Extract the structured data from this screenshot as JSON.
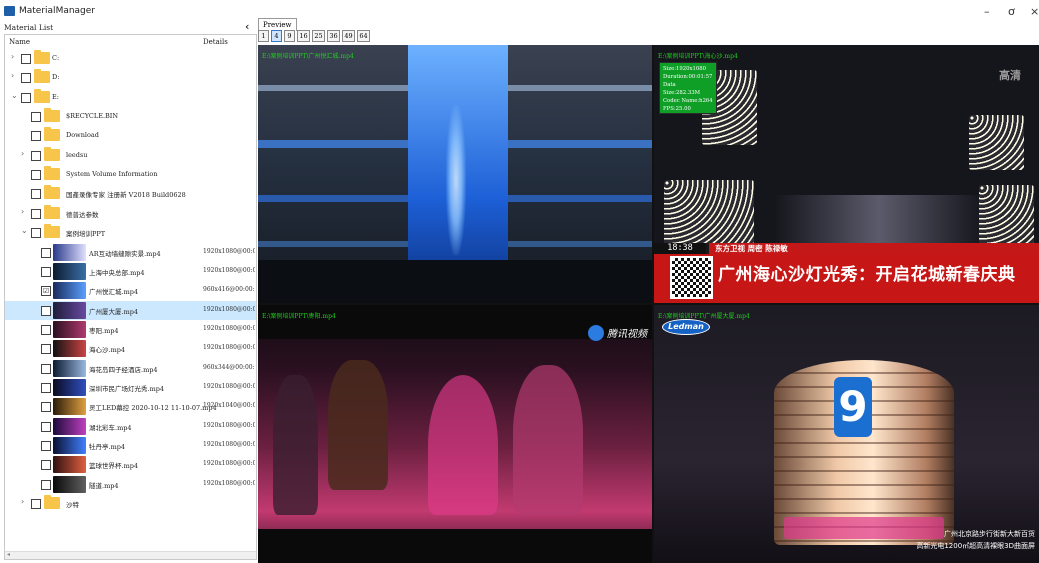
{
  "window": {
    "title": "MaterialManager",
    "controls": {
      "minimize": "–",
      "maximize": "ơ",
      "close": "×"
    }
  },
  "panel": {
    "title": "Material List",
    "collapse": "‹",
    "columns": {
      "name": "Name",
      "details": "Details"
    }
  },
  "tree": [
    {
      "label": "C:",
      "expander": "›",
      "checkbox": ""
    },
    {
      "label": "D:",
      "expander": "›",
      "checkbox": ""
    },
    {
      "label": "E:",
      "expander": "⌄",
      "checkbox": ""
    },
    {
      "label": "$RECYCLE.BIN",
      "checkbox": ""
    },
    {
      "label": "Download",
      "checkbox": ""
    },
    {
      "label": "leedsu",
      "expander": "›",
      "checkbox": ""
    },
    {
      "label": "System Volume Information",
      "checkbox": ""
    },
    {
      "label": "国產录像专家 注册新 V2018 Build0628",
      "checkbox": ""
    },
    {
      "label": "德普达参数",
      "expander": "›",
      "checkbox": ""
    },
    {
      "label": "案例培训PPT",
      "expander": "⌄",
      "checkbox": ""
    },
    {
      "label": "AR互动墙缝隙实景.mp4",
      "details": "1920x1080@00:0",
      "checkbox": ""
    },
    {
      "label": "上海中央总部.mp4",
      "details": "1920x1080@00:0",
      "checkbox": ""
    },
    {
      "label": "广州悦汇城.mp4",
      "details": "960x416@00:00:1",
      "checkbox": "☑"
    },
    {
      "label": "广州厦大厦.mp4",
      "details": "1920x1080@00:0",
      "checkbox": ""
    },
    {
      "label": "枣阳.mp4",
      "details": "1920x1080@00:0",
      "checkbox": ""
    },
    {
      "label": "海心沙.mp4",
      "details": "1920x1080@00:0",
      "checkbox": ""
    },
    {
      "label": "海花岛四子经酒店.mp4",
      "details": "960x344@00:00:1",
      "checkbox": ""
    },
    {
      "label": "深圳市民广场灯光秀.mp4",
      "details": "1920x1080@00:0",
      "checkbox": ""
    },
    {
      "label": "灵工LED幕控 2020-10-12 11-10-07.mp4",
      "details": "1920x1040@00:0",
      "checkbox": ""
    },
    {
      "label": "湖北彩车.mp4",
      "details": "1920x1080@00:0",
      "checkbox": ""
    },
    {
      "label": "牡丹亭.mp4",
      "details": "1920x1080@00:0",
      "checkbox": ""
    },
    {
      "label": "篮球世界杯.mp4",
      "details": "1920x1080@00:0",
      "checkbox": ""
    },
    {
      "label": "隧道.mp4",
      "details": "1920x1080@00:0",
      "checkbox": ""
    },
    {
      "label": "沙特",
      "expander": "›",
      "checkbox": ""
    }
  ],
  "preview": {
    "tab": "Preview",
    "grid_options": [
      "1",
      "4",
      "9",
      "16",
      "25",
      "36",
      "49",
      "64"
    ],
    "active_grid": "4",
    "cells": [
      {
        "path": "E:\\案例培训PPT\\广州悦汇城.mp4"
      },
      {
        "path": "E:\\案例培训PPT\\海心沙.mp4",
        "info": [
          "Size:1920x1080",
          "Duration:00:01:57",
          "Data Size:282.33M",
          "Codec Name:h264",
          "FPS:25.00"
        ],
        "corner_logo": "高清",
        "ticker_time": "18:38",
        "ticker_text": "东方卫视 周密 陈禄敏",
        "headline": "广州海心沙灯光秀：开启花城新春庆典"
      },
      {
        "path": "E:\\案例培训PPT\\枣阳.mp4",
        "watermark": "腾讯视频"
      },
      {
        "path": "E:\\案例培训PPT\\广州厦大厦.mp4",
        "logo": "Ledman",
        "building_number": "9",
        "caption_1": "广州北京路步行街新大新百货",
        "caption_2": "高新光电1200㎡超高清裸眼3D曲面屏"
      }
    ]
  }
}
